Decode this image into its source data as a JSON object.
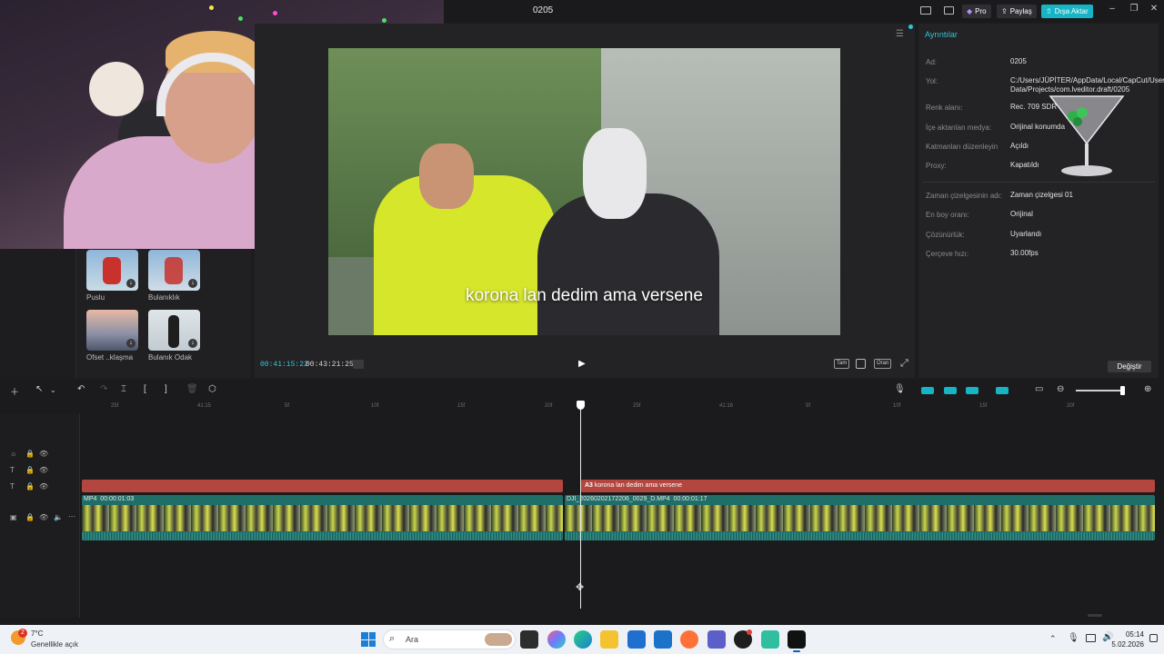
{
  "window": {
    "title": "0205",
    "pro_label": "Pro",
    "share_label": "Paylaş",
    "export_label": "Dışa Aktar"
  },
  "media_panel": {
    "effects": [
      {
        "label": "Puslu"
      },
      {
        "label": "Bulanıklık"
      },
      {
        "label": "Ofset ..klaşma"
      },
      {
        "label": "Bulanık Odak"
      }
    ]
  },
  "player": {
    "subtitle": "korona lan dedim ama versene",
    "current_time": "00:41:15:22",
    "total_time": "00:43:21:25",
    "controls": {
      "full": "Tam",
      "ratio": "Oran"
    }
  },
  "details": {
    "title": "Ayrıntılar",
    "rows": [
      {
        "key": "Ad:",
        "value": "0205"
      },
      {
        "key": "Yol:",
        "value": "C:/Users/JÜPİTER/AppData/Local/CapCut/User Data/Projects/com.lveditor.draft/0205"
      },
      {
        "key": "Renk alanı:",
        "value": "Rec. 709 SDR"
      },
      {
        "key": "İçe aktarılan medya:",
        "value": "Orijinal konumda"
      },
      {
        "key": "Katmanları düzenleyin",
        "value": "Açıldı"
      },
      {
        "key": "Proxy:",
        "value": "Kapatıldı"
      },
      {
        "key": "Zaman çizelgesinin adı:",
        "value": "Zaman çizelgesi 01"
      },
      {
        "key": "En boy oranı:",
        "value": "Orijinal"
      },
      {
        "key": "Çözünürlük:",
        "value": "Uyarlandı"
      },
      {
        "key": "Çerçeve hızı:",
        "value": "30.00fps"
      }
    ],
    "change_label": "Değiştir"
  },
  "timeline": {
    "ruler_ticks": [
      "25f",
      "41:15",
      "5f",
      "10f",
      "15f",
      "20f",
      "25f",
      "41:16",
      "5f",
      "10f",
      "15f",
      "20f"
    ],
    "text_clip_label": "korona lan dedim ama versene",
    "text_clip_badge": "A3",
    "video_clip_1": {
      "name": "MP4",
      "duration": "00:00:01:03"
    },
    "video_clip_2": {
      "name": "DJI_20260202172206_0029_D.MP4",
      "duration": "00:00:01:17"
    }
  },
  "taskbar": {
    "weather_temp": "7°C",
    "weather_desc": "Genellikle açık",
    "weather_badge": "2",
    "search_placeholder": "Ara",
    "time": "05:14",
    "date": "5.02.2026"
  }
}
